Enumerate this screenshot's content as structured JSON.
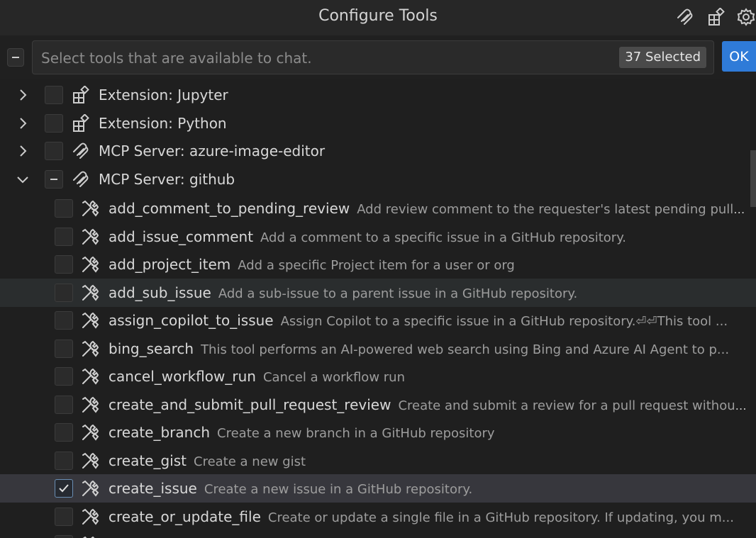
{
  "title": "Configure Tools",
  "search": {
    "placeholder": "Select tools that are available to chat.",
    "value": "",
    "selected_count": "37 Selected"
  },
  "ok_label": "OK",
  "groups": [
    {
      "label": "Extension: Jupyter",
      "icon": "extensions-icon",
      "expanded": false,
      "state": "unchecked"
    },
    {
      "label": "Extension: Python",
      "icon": "extensions-icon",
      "expanded": false,
      "state": "unchecked"
    },
    {
      "label": "MCP Server: azure-image-editor",
      "icon": "mcp-icon",
      "expanded": false,
      "state": "unchecked"
    },
    {
      "label": "MCP Server: github",
      "icon": "mcp-icon",
      "expanded": true,
      "state": "partial"
    }
  ],
  "tools": [
    {
      "name": "add_comment_to_pending_review",
      "desc": "Add review comment to the requester's latest pending pull request review.",
      "checked": false
    },
    {
      "name": "add_issue_comment",
      "desc": "Add a comment to a specific issue in a GitHub repository.",
      "checked": false
    },
    {
      "name": "add_project_item",
      "desc": "Add a specific Project item for a user or org",
      "checked": false
    },
    {
      "name": "add_sub_issue",
      "desc": "Add a sub-issue to a parent issue in a GitHub repository.",
      "checked": false
    },
    {
      "name": "assign_copilot_to_issue",
      "desc": "Assign Copilot to a specific issue in a GitHub repository.⏎⏎This tool ...",
      "checked": false
    },
    {
      "name": "bing_search",
      "desc": "This tool performs an AI-powered web search using Bing and Azure AI Agent to p...",
      "checked": false
    },
    {
      "name": "cancel_workflow_run",
      "desc": "Cancel a workflow run",
      "checked": false
    },
    {
      "name": "create_and_submit_pull_request_review",
      "desc": "Create and submit a review for a pull request without...",
      "checked": false
    },
    {
      "name": "create_branch",
      "desc": "Create a new branch in a GitHub repository",
      "checked": false
    },
    {
      "name": "create_gist",
      "desc": "Create a new gist",
      "checked": false
    },
    {
      "name": "create_issue",
      "desc": "Create a new issue in a GitHub repository.",
      "checked": true
    },
    {
      "name": "create_or_update_file",
      "desc": "Create or update a single file in a GitHub repository. If updating, you m...",
      "checked": false
    },
    {
      "name": "",
      "desc": "",
      "checked": false
    }
  ],
  "hover_index": 3,
  "selected_index": 10,
  "colors": {
    "accent": "#2f7bd8",
    "background": "#1f1f1f",
    "selected_row": "#37373d",
    "hover_row": "#2a2d2e"
  }
}
